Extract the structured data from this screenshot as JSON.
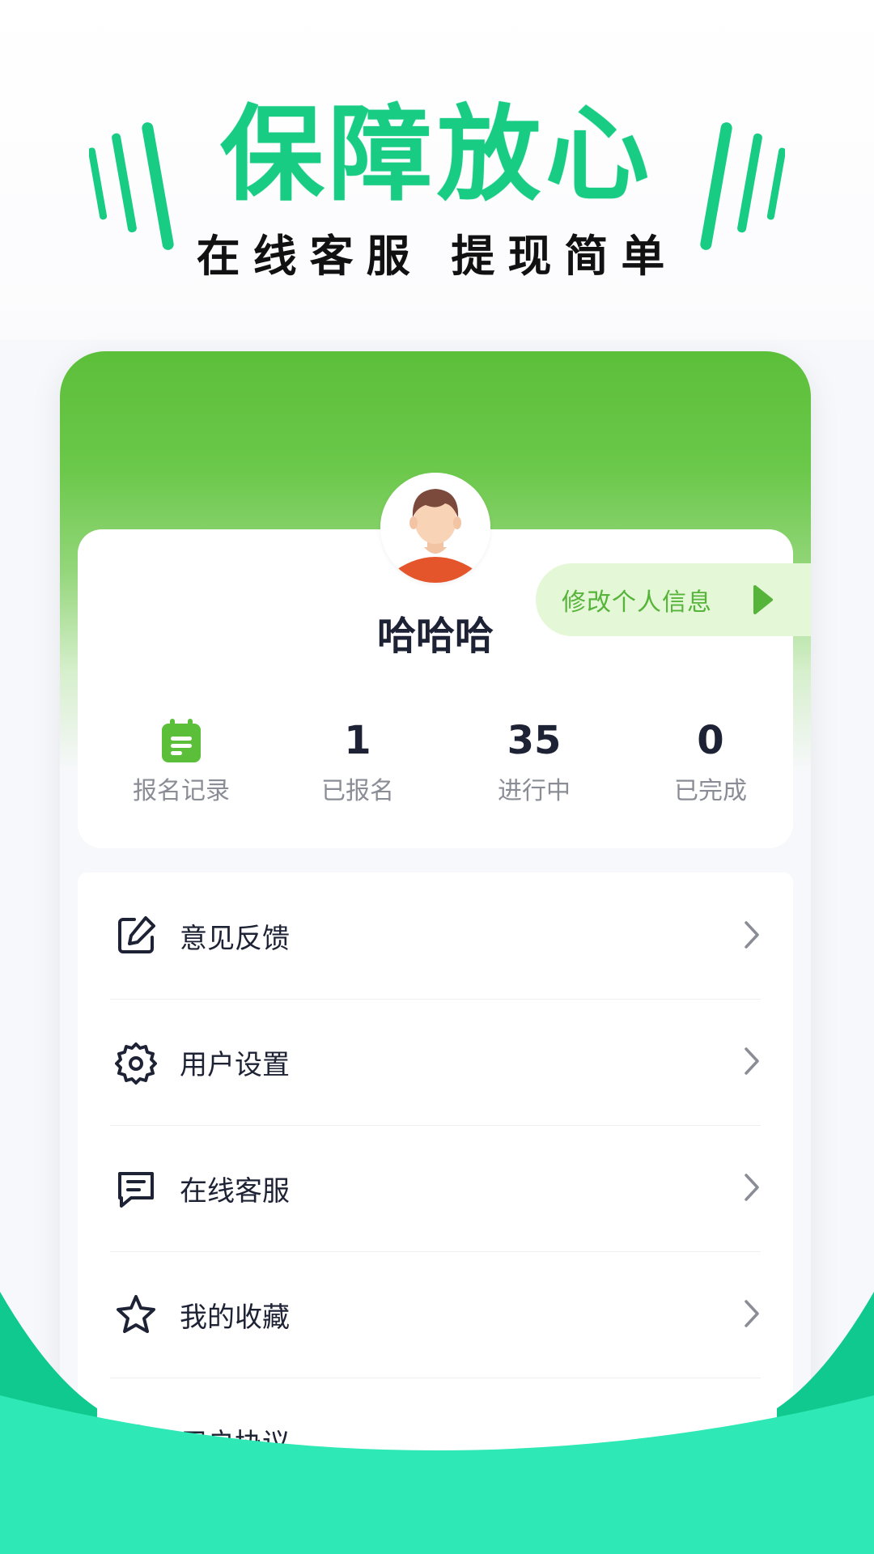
{
  "banner": {
    "headline": "保障放心",
    "subheadline": "在线客服 提现简单"
  },
  "profile": {
    "username": "哈哈哈",
    "edit_label": "修改个人信息"
  },
  "stats": [
    {
      "icon": "clipboard-icon",
      "label": "报名记录"
    },
    {
      "value": "1",
      "label": "已报名"
    },
    {
      "value": "35",
      "label": "进行中"
    },
    {
      "value": "0",
      "label": "已完成"
    }
  ],
  "menu": [
    {
      "icon": "edit-icon",
      "label": "意见反馈"
    },
    {
      "icon": "gear-icon",
      "label": "用户设置"
    },
    {
      "icon": "chat-icon",
      "label": "在线客服"
    },
    {
      "icon": "star-icon",
      "label": "我的收藏"
    },
    {
      "icon": "compass-icon",
      "label": "用户协议"
    }
  ],
  "colors": {
    "brand_green": "#19cc84",
    "header_green": "#5cbf3a",
    "pill_bg": "#e4f7d6",
    "text_dark": "#1e2235",
    "text_gray": "#8a8d96",
    "wave_light": "#2ee8b5",
    "wave_dark": "#0fc98e"
  }
}
